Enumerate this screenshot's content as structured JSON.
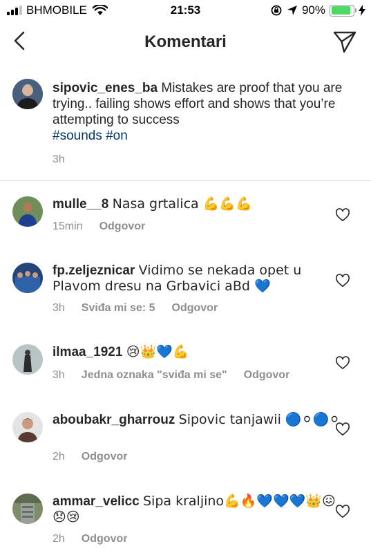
{
  "status_bar": {
    "carrier": "BHMOBILE",
    "time": "21:53",
    "battery": "90%",
    "battery_level": 0.9
  },
  "header": {
    "title": "Komentari"
  },
  "caption": {
    "username": "sipovic_enes_ba",
    "text": "Mistakes are proof that you are trying.. failing shows effort and shows that you’re attempting to success",
    "hashtags": "#sounds #on",
    "time": "3h"
  },
  "comments": [
    {
      "username": "mulle__8",
      "text": "Nasa grtalica 💪💪💪",
      "time": "15min",
      "likes": "",
      "reply": "Odgovor"
    },
    {
      "username": "fp.zeljeznicar",
      "text": "Vidimo se nekada opet u Plavom dresu na Grbavici aBd 💙",
      "time": "3h",
      "likes": "Sviđa mi se: 5",
      "reply": "Odgovor"
    },
    {
      "username": "ilmaa_1921",
      "text": "😢👑💙💪",
      "time": "3h",
      "likes": "Jedna oznaka \"sviđa mi se\"",
      "reply": "Odgovor"
    },
    {
      "username": "aboubakr_gharrouz",
      "text": "Sipovic tanjawii 🔵⚪🔵⚪",
      "time": "2h",
      "likes": "",
      "reply": "Odgovor"
    },
    {
      "username": "ammar_velicc",
      "text": "Sipa kraljino💪🔥💙💙💙👑😖😞😢",
      "time": "2h",
      "likes": "",
      "reply": "Odgovor"
    }
  ]
}
